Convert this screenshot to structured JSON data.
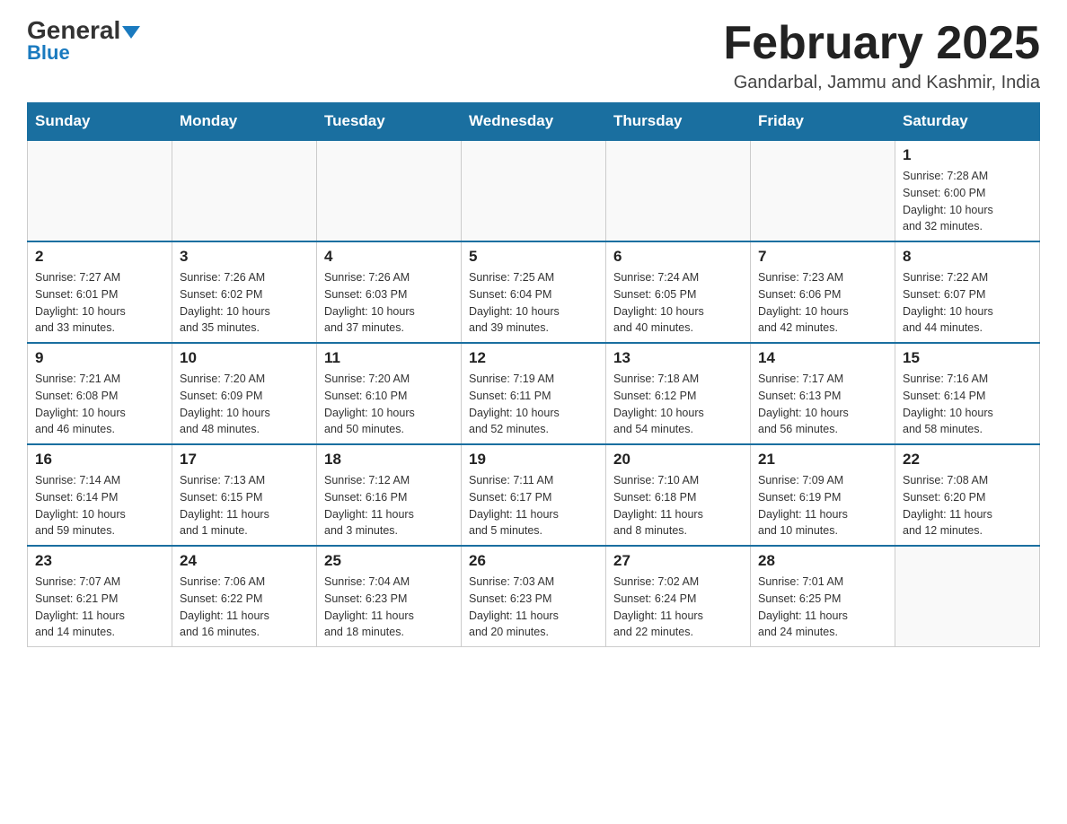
{
  "logo": {
    "general": "General",
    "blue": "Blue"
  },
  "header": {
    "month_title": "February 2025",
    "location": "Gandarbal, Jammu and Kashmir, India"
  },
  "days_of_week": [
    "Sunday",
    "Monday",
    "Tuesday",
    "Wednesday",
    "Thursday",
    "Friday",
    "Saturday"
  ],
  "weeks": [
    [
      {
        "day": "",
        "info": ""
      },
      {
        "day": "",
        "info": ""
      },
      {
        "day": "",
        "info": ""
      },
      {
        "day": "",
        "info": ""
      },
      {
        "day": "",
        "info": ""
      },
      {
        "day": "",
        "info": ""
      },
      {
        "day": "1",
        "info": "Sunrise: 7:28 AM\nSunset: 6:00 PM\nDaylight: 10 hours\nand 32 minutes."
      }
    ],
    [
      {
        "day": "2",
        "info": "Sunrise: 7:27 AM\nSunset: 6:01 PM\nDaylight: 10 hours\nand 33 minutes."
      },
      {
        "day": "3",
        "info": "Sunrise: 7:26 AM\nSunset: 6:02 PM\nDaylight: 10 hours\nand 35 minutes."
      },
      {
        "day": "4",
        "info": "Sunrise: 7:26 AM\nSunset: 6:03 PM\nDaylight: 10 hours\nand 37 minutes."
      },
      {
        "day": "5",
        "info": "Sunrise: 7:25 AM\nSunset: 6:04 PM\nDaylight: 10 hours\nand 39 minutes."
      },
      {
        "day": "6",
        "info": "Sunrise: 7:24 AM\nSunset: 6:05 PM\nDaylight: 10 hours\nand 40 minutes."
      },
      {
        "day": "7",
        "info": "Sunrise: 7:23 AM\nSunset: 6:06 PM\nDaylight: 10 hours\nand 42 minutes."
      },
      {
        "day": "8",
        "info": "Sunrise: 7:22 AM\nSunset: 6:07 PM\nDaylight: 10 hours\nand 44 minutes."
      }
    ],
    [
      {
        "day": "9",
        "info": "Sunrise: 7:21 AM\nSunset: 6:08 PM\nDaylight: 10 hours\nand 46 minutes."
      },
      {
        "day": "10",
        "info": "Sunrise: 7:20 AM\nSunset: 6:09 PM\nDaylight: 10 hours\nand 48 minutes."
      },
      {
        "day": "11",
        "info": "Sunrise: 7:20 AM\nSunset: 6:10 PM\nDaylight: 10 hours\nand 50 minutes."
      },
      {
        "day": "12",
        "info": "Sunrise: 7:19 AM\nSunset: 6:11 PM\nDaylight: 10 hours\nand 52 minutes."
      },
      {
        "day": "13",
        "info": "Sunrise: 7:18 AM\nSunset: 6:12 PM\nDaylight: 10 hours\nand 54 minutes."
      },
      {
        "day": "14",
        "info": "Sunrise: 7:17 AM\nSunset: 6:13 PM\nDaylight: 10 hours\nand 56 minutes."
      },
      {
        "day": "15",
        "info": "Sunrise: 7:16 AM\nSunset: 6:14 PM\nDaylight: 10 hours\nand 58 minutes."
      }
    ],
    [
      {
        "day": "16",
        "info": "Sunrise: 7:14 AM\nSunset: 6:14 PM\nDaylight: 10 hours\nand 59 minutes."
      },
      {
        "day": "17",
        "info": "Sunrise: 7:13 AM\nSunset: 6:15 PM\nDaylight: 11 hours\nand 1 minute."
      },
      {
        "day": "18",
        "info": "Sunrise: 7:12 AM\nSunset: 6:16 PM\nDaylight: 11 hours\nand 3 minutes."
      },
      {
        "day": "19",
        "info": "Sunrise: 7:11 AM\nSunset: 6:17 PM\nDaylight: 11 hours\nand 5 minutes."
      },
      {
        "day": "20",
        "info": "Sunrise: 7:10 AM\nSunset: 6:18 PM\nDaylight: 11 hours\nand 8 minutes."
      },
      {
        "day": "21",
        "info": "Sunrise: 7:09 AM\nSunset: 6:19 PM\nDaylight: 11 hours\nand 10 minutes."
      },
      {
        "day": "22",
        "info": "Sunrise: 7:08 AM\nSunset: 6:20 PM\nDaylight: 11 hours\nand 12 minutes."
      }
    ],
    [
      {
        "day": "23",
        "info": "Sunrise: 7:07 AM\nSunset: 6:21 PM\nDaylight: 11 hours\nand 14 minutes."
      },
      {
        "day": "24",
        "info": "Sunrise: 7:06 AM\nSunset: 6:22 PM\nDaylight: 11 hours\nand 16 minutes."
      },
      {
        "day": "25",
        "info": "Sunrise: 7:04 AM\nSunset: 6:23 PM\nDaylight: 11 hours\nand 18 minutes."
      },
      {
        "day": "26",
        "info": "Sunrise: 7:03 AM\nSunset: 6:23 PM\nDaylight: 11 hours\nand 20 minutes."
      },
      {
        "day": "27",
        "info": "Sunrise: 7:02 AM\nSunset: 6:24 PM\nDaylight: 11 hours\nand 22 minutes."
      },
      {
        "day": "28",
        "info": "Sunrise: 7:01 AM\nSunset: 6:25 PM\nDaylight: 11 hours\nand 24 minutes."
      },
      {
        "day": "",
        "info": ""
      }
    ]
  ]
}
